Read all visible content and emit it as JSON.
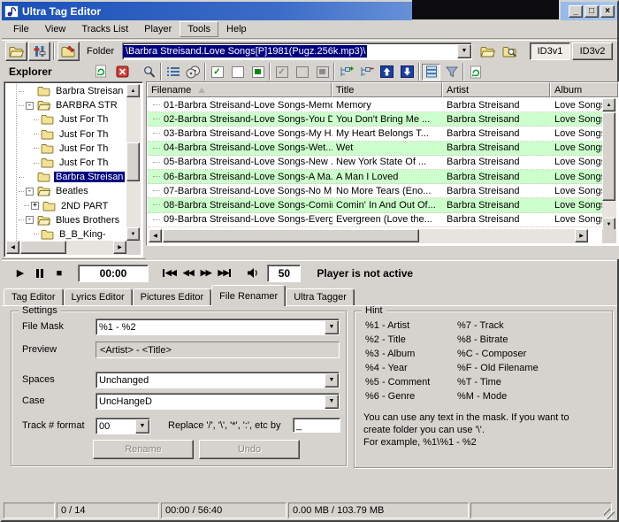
{
  "window": {
    "title": "Ultra Tag Editor",
    "controls": {
      "minimize": "_",
      "maximize": "□",
      "close": "×"
    }
  },
  "menu": [
    "File",
    "View",
    "Tracks List",
    "Player",
    "Tools",
    "Help"
  ],
  "toolbar": {
    "folder_label": "Folder",
    "folder_path": "\\Barbra Streisand.Love Songs[P]1981(Pugz.256k.mp3)\\",
    "id3v1_label": "ID3v1",
    "id3v2_label": "ID3v2"
  },
  "explorer": {
    "title": "Explorer",
    "tree": [
      {
        "label": "Barbra Streisan",
        "level": 0,
        "expander": "",
        "icon": "folder-closed",
        "selected": false
      },
      {
        "label": "BARBRA STR",
        "level": 0,
        "expander": "-",
        "icon": "folder-open",
        "selected": false
      },
      {
        "label": "Just For Th",
        "level": 1,
        "expander": "",
        "icon": "folder-closed",
        "selected": false
      },
      {
        "label": "Just For Th",
        "level": 1,
        "expander": "",
        "icon": "folder-closed",
        "selected": false
      },
      {
        "label": "Just For Th",
        "level": 1,
        "expander": "",
        "icon": "folder-closed",
        "selected": false
      },
      {
        "label": "Just For Th",
        "level": 1,
        "expander": "",
        "icon": "folder-closed",
        "selected": false
      },
      {
        "label": "Barbra Streisan",
        "level": 0,
        "expander": "",
        "icon": "folder-closed",
        "selected": true
      },
      {
        "label": "Beatles",
        "level": 0,
        "expander": "-",
        "icon": "folder-open",
        "selected": false
      },
      {
        "label": "2ND PART",
        "level": 1,
        "expander": "+",
        "icon": "folder-closed",
        "selected": false
      },
      {
        "label": "Blues Brothers",
        "level": 0,
        "expander": "-",
        "icon": "folder-open",
        "selected": false
      },
      {
        "label": "B_B_King-",
        "level": 1,
        "expander": "",
        "icon": "folder-closed",
        "selected": false
      }
    ]
  },
  "filelist": {
    "columns": [
      "Filename",
      "Title",
      "Artist",
      "Album"
    ],
    "rows": [
      [
        "01-Barbra Streisand-Love Songs-Memo...",
        "Memory",
        "Barbra Streisand",
        "Love Songs"
      ],
      [
        "02-Barbra Streisand-Love Songs-You D...",
        "You Don't Bring Me ...",
        "Barbra Streisand",
        "Love Songs"
      ],
      [
        "03-Barbra Streisand-Love Songs-My H...",
        "My Heart Belongs T...",
        "Barbra Streisand",
        "Love Songs"
      ],
      [
        "04-Barbra Streisand-Love Songs-Wet....",
        "Wet",
        "Barbra Streisand",
        "Love Songs"
      ],
      [
        "05-Barbra Streisand-Love Songs-New ...",
        "New York State Of ...",
        "Barbra Streisand",
        "Love Songs"
      ],
      [
        "06-Barbra Streisand-Love Songs-A Ma...",
        "A Man I Loved",
        "Barbra Streisand",
        "Love Songs"
      ],
      [
        "07-Barbra Streisand-Love Songs-No M...",
        "No More Tears (Eno...",
        "Barbra Streisand",
        "Love Songs"
      ],
      [
        "08-Barbra Streisand-Love Songs-Comin...",
        "Comin' In And Out Of...",
        "Barbra Streisand",
        "Love Songs"
      ],
      [
        "09-Barbra Streisand-Love Songs-Everg...",
        "Evergreen (Love the...",
        "Barbra Streisand",
        "Love Songs"
      ]
    ]
  },
  "player": {
    "time": "00:00",
    "volume": "50",
    "status": "Player is not active"
  },
  "tabs": {
    "items": [
      "Tag Editor",
      "Lyrics Editor",
      "Pictures Editor",
      "File Renamer",
      "Ultra Tagger"
    ],
    "active": "File Renamer"
  },
  "renamer": {
    "group_title": "Settings",
    "file_mask_label": "File Mask",
    "file_mask_value": "%1 - %2",
    "preview_label": "Preview",
    "preview_value": "<Artist> - <Title>",
    "spaces_label": "Spaces",
    "spaces_value": "Unchanged",
    "case_label": "Case",
    "case_value": "UncHangeD",
    "track_format_label": "Track # format",
    "track_format_value": "00",
    "replace_label": "Replace '/', '\\', '*', ':', etc by",
    "replace_value": "_",
    "rename_label": "Rename",
    "undo_label": "Undo"
  },
  "hint": {
    "group_title": "Hint",
    "col1": [
      "%1 - Artist",
      "%2 - Title",
      "%3 - Album",
      "%4 - Year",
      "%5 - Comment",
      "%6 - Genre"
    ],
    "col2": [
      "%7 - Track",
      "%8 - Bitrate",
      "%C - Composer",
      "%F - Old Filename",
      "%T - Time",
      "%M - Mode"
    ],
    "note": [
      "You can use any text in the mask. If you want to",
      "create folder you can use '\\'.",
      "For example, %1\\%1 - %2"
    ]
  },
  "statusbar": {
    "files": "0 / 14",
    "time": "00:00 / 56:40",
    "size": "0.00 MB / 103.79 MB"
  },
  "icons": {
    "dropdown": "▼",
    "scroll_up": "▲",
    "scroll_down": "▼",
    "scroll_left": "◀",
    "scroll_right": "▶",
    "play": "▶",
    "stop": "■",
    "rewind": "◀◀",
    "forward": "▶▶"
  }
}
